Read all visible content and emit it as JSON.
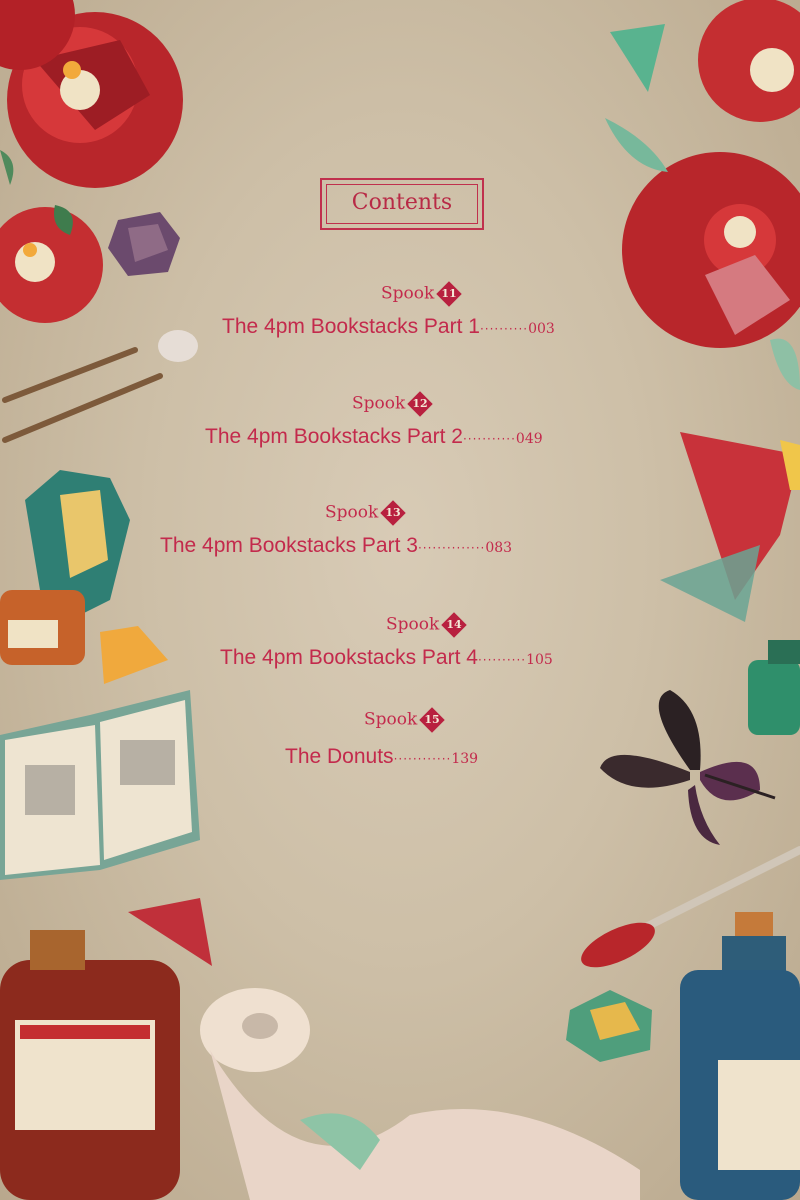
{
  "contents": {
    "heading": "Contents",
    "entries": [
      {
        "spook_word": "Spook",
        "spook_number": "11",
        "title": "The 4pm Bookstacks Part 1",
        "dots": "··········",
        "page": "003"
      },
      {
        "spook_word": "Spook",
        "spook_number": "12",
        "title": "The 4pm Bookstacks Part 2",
        "dots": "···········",
        "page": "049"
      },
      {
        "spook_word": "Spook",
        "spook_number": "13",
        "title": "The 4pm Bookstacks Part 3",
        "dots": "··············",
        "page": "083"
      },
      {
        "spook_word": "Spook",
        "spook_number": "14",
        "title": "The 4pm Bookstacks Part 4",
        "dots": "··········",
        "page": "105"
      },
      {
        "spook_word": "Spook",
        "spook_number": "15",
        "title": "The Donuts",
        "dots": "············",
        "page": "139"
      }
    ]
  },
  "colors": {
    "accent": "#c32a4c",
    "background": "#d2c4ad"
  }
}
